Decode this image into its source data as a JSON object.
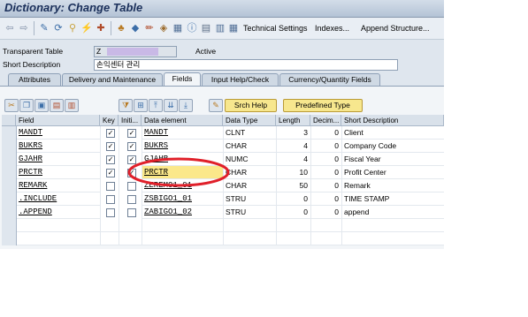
{
  "window": {
    "title": "Dictionary: Change Table"
  },
  "toolbar": {
    "technical_settings": "Technical Settings",
    "indexes": "Indexes...",
    "append_structure": "Append Structure..."
  },
  "header": {
    "table_type_label": "Transparent Table",
    "table_name": "Z",
    "status": "Active",
    "short_description_label": "Short Description",
    "short_description": "손익센터 관리"
  },
  "tabs": [
    "Attributes",
    "Delivery and Maintenance",
    "Fields",
    "Input Help/Check",
    "Currency/Quantity Fields"
  ],
  "active_tab": "Fields",
  "fields_toolbar": {
    "srch_help": "Srch Help",
    "predefined_type": "Predefined Type"
  },
  "columns": [
    "Field",
    "Key",
    "Initi...",
    "Data element",
    "Data Type",
    "Length",
    "Decim...",
    "Short Description"
  ],
  "rows": [
    {
      "field": "MANDT",
      "key": true,
      "init": true,
      "data_element": "MANDT",
      "data_type": "CLNT",
      "length": "3",
      "decimals": "0",
      "short_description": "Client"
    },
    {
      "field": "BUKRS",
      "key": true,
      "init": true,
      "data_element": "BUKRS",
      "data_type": "CHAR",
      "length": "4",
      "decimals": "0",
      "short_description": "Company Code"
    },
    {
      "field": "GJAHR",
      "key": true,
      "init": true,
      "data_element": "GJAHR",
      "data_type": "NUMC",
      "length": "4",
      "decimals": "0",
      "short_description": "Fiscal Year"
    },
    {
      "field": "PRCTR",
      "key": true,
      "init": true,
      "data_element": "PRCTR",
      "data_type": "CHAR",
      "length": "10",
      "decimals": "0",
      "short_description": "Profit Center"
    },
    {
      "field": "REMARK",
      "key": false,
      "init": false,
      "data_element": "ZEREMO1_01",
      "data_type": "CHAR",
      "length": "50",
      "decimals": "0",
      "short_description": "Remark"
    },
    {
      "field": ".INCLUDE",
      "key": false,
      "init": false,
      "data_element": "ZSBIGO1_01",
      "data_type": "STRU",
      "length": "0",
      "decimals": "0",
      "short_description": "TIME STAMP"
    },
    {
      "field": ".APPEND",
      "key": false,
      "init": false,
      "data_element": "ZABIGO1_02",
      "data_type": "STRU",
      "length": "0",
      "decimals": "0",
      "short_description": "append"
    }
  ],
  "colors": {
    "highlight_circle": "#e0202a",
    "selected_cell": "#fbe88a",
    "button_yellow": "#f7e78e"
  }
}
